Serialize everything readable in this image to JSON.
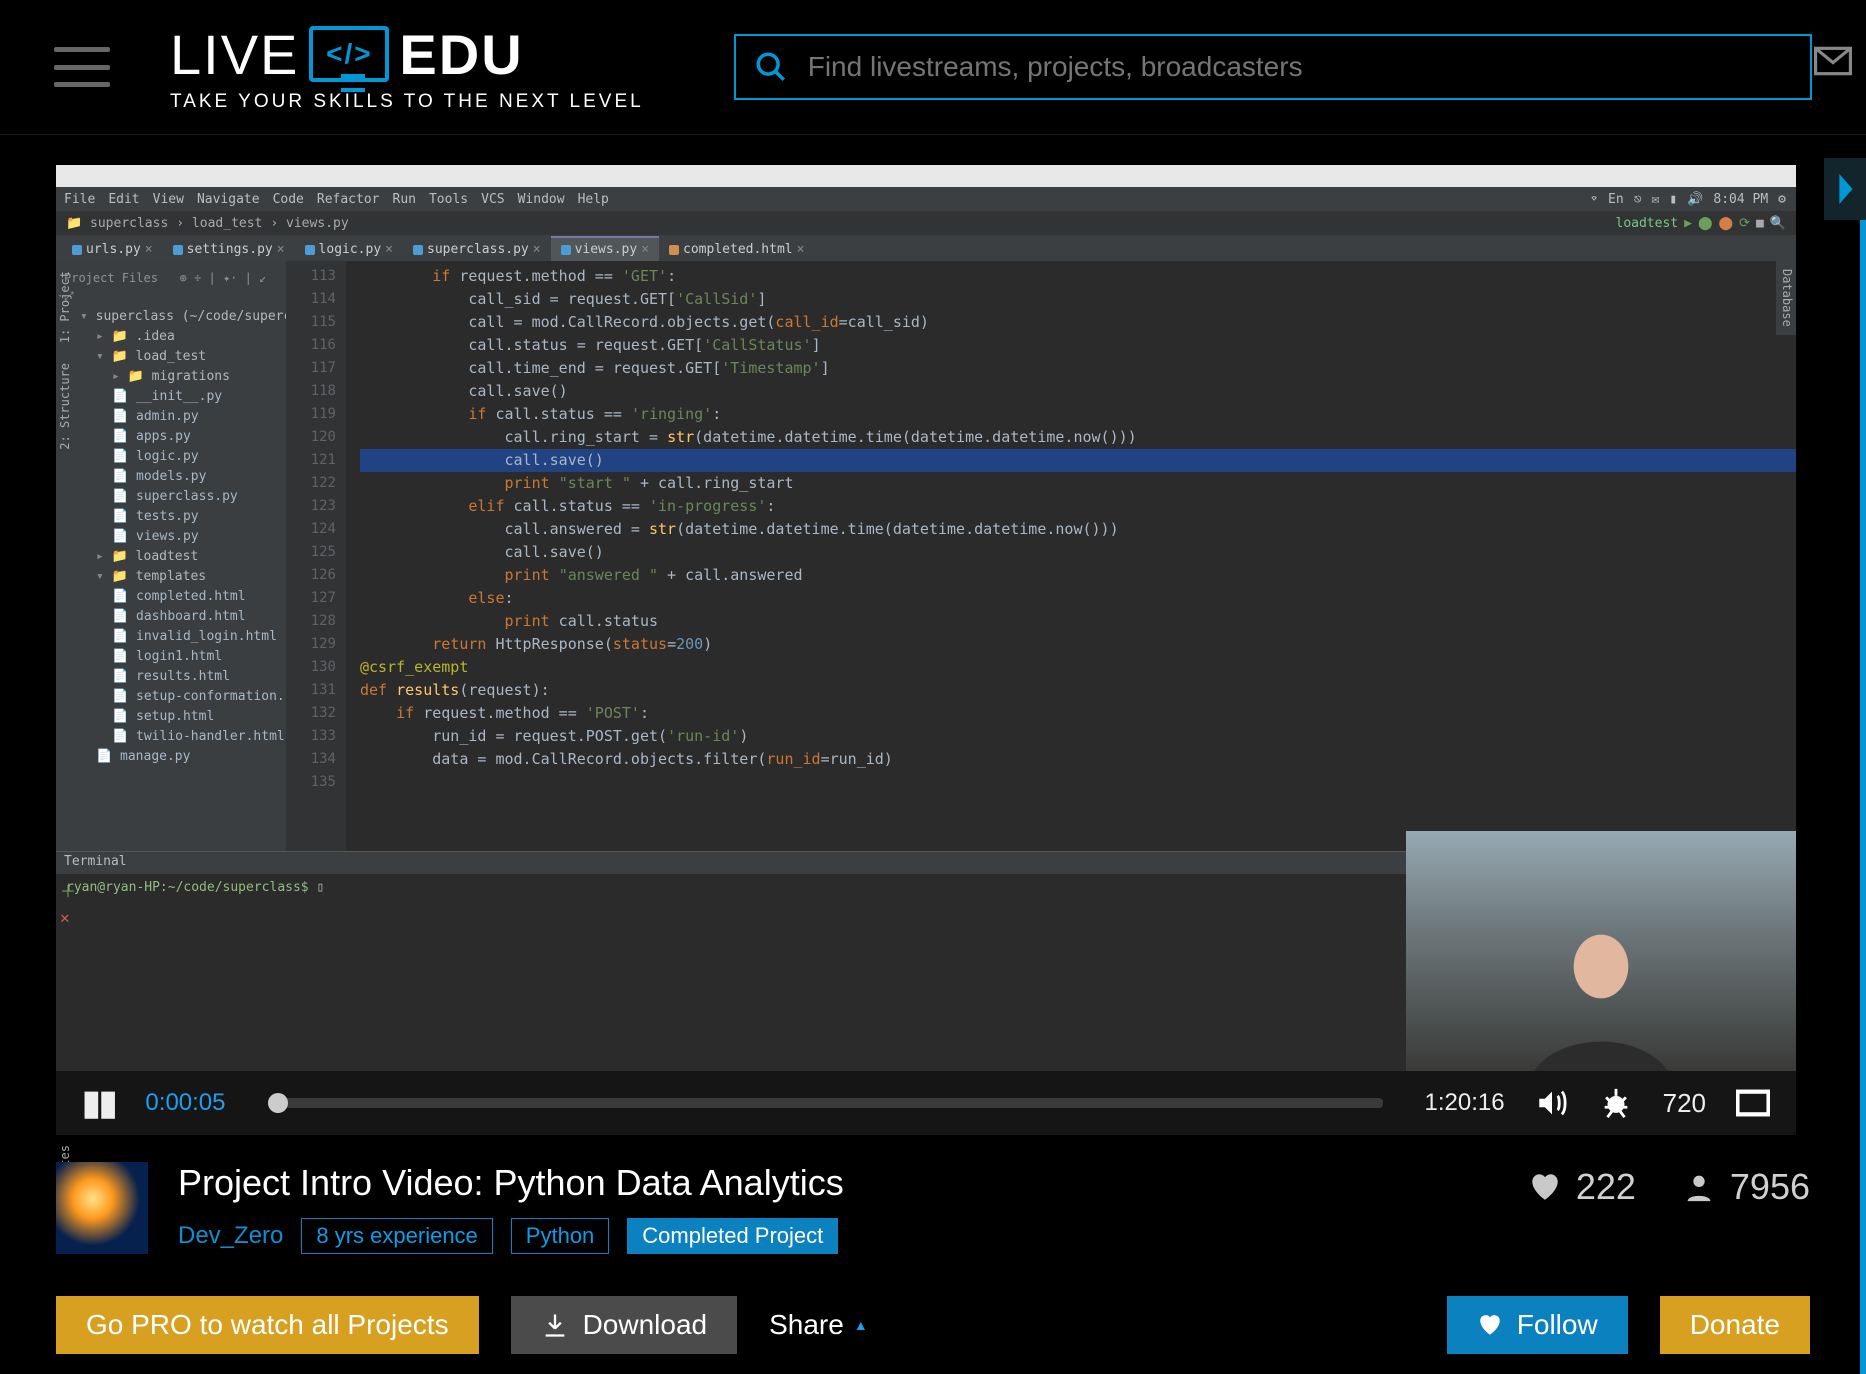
{
  "header": {
    "logo_a": "LIVE",
    "logo_code": "</>",
    "logo_b": "EDU",
    "tagline": "TAKE YOUR SKILLS TO THE NEXT LEVEL",
    "search_placeholder": "Find livestreams, projects, broadcasters"
  },
  "player": {
    "current_time": "0:00:05",
    "duration": "1:20:16",
    "quality": "720"
  },
  "video_meta": {
    "title": "Project Intro Video: Python Data Analytics",
    "creator": "Dev_Zero",
    "tags": [
      "8 yrs experience",
      "Python"
    ],
    "status_tag": "Completed Project",
    "likes": "222",
    "views": "7956"
  },
  "actions": {
    "go_pro": "Go PRO to watch all Projects",
    "download": "Download",
    "share": "Share",
    "follow": "Follow",
    "donate": "Donate"
  },
  "ide": {
    "menubar": [
      "File",
      "Edit",
      "View",
      "Navigate",
      "Code",
      "Refactor",
      "Run",
      "Tools",
      "VCS",
      "Window",
      "Help"
    ],
    "clock": "8:04 PM",
    "breadcrumb": [
      "superclass",
      "load_test",
      "views.py"
    ],
    "run_config": "loadtest",
    "project_header": "Project Files",
    "root": "superclass (~/code/superclass)",
    "tree": [
      {
        "t": "dir",
        "d": 1,
        "n": ".idea"
      },
      {
        "t": "diro",
        "d": 1,
        "n": "load_test"
      },
      {
        "t": "dir",
        "d": 2,
        "n": "migrations"
      },
      {
        "t": "f",
        "d": 2,
        "n": "__init__.py"
      },
      {
        "t": "f",
        "d": 2,
        "n": "admin.py"
      },
      {
        "t": "f",
        "d": 2,
        "n": "apps.py"
      },
      {
        "t": "f",
        "d": 2,
        "n": "logic.py"
      },
      {
        "t": "f",
        "d": 2,
        "n": "models.py"
      },
      {
        "t": "f",
        "d": 2,
        "n": "superclass.py"
      },
      {
        "t": "f",
        "d": 2,
        "n": "tests.py"
      },
      {
        "t": "f",
        "d": 2,
        "n": "views.py",
        "sel": true
      },
      {
        "t": "dir",
        "d": 1,
        "n": "loadtest"
      },
      {
        "t": "diro",
        "d": 1,
        "n": "templates"
      },
      {
        "t": "f",
        "d": 2,
        "n": "completed.html"
      },
      {
        "t": "f",
        "d": 2,
        "n": "dashboard.html"
      },
      {
        "t": "f",
        "d": 2,
        "n": "invalid_login.html"
      },
      {
        "t": "f",
        "d": 2,
        "n": "login1.html"
      },
      {
        "t": "f",
        "d": 2,
        "n": "results.html"
      },
      {
        "t": "f",
        "d": 2,
        "n": "setup-conformation.html"
      },
      {
        "t": "f",
        "d": 2,
        "n": "setup.html"
      },
      {
        "t": "f",
        "d": 2,
        "n": "twilio-handler.html"
      },
      {
        "t": "f",
        "d": 1,
        "n": "manage.py"
      }
    ],
    "tabs": [
      {
        "n": "urls.py",
        "ic": "b"
      },
      {
        "n": "settings.py",
        "ic": "b"
      },
      {
        "n": "logic.py",
        "ic": "b"
      },
      {
        "n": "superclass.py",
        "ic": "b"
      },
      {
        "n": "views.py",
        "ic": "b",
        "active": true
      },
      {
        "n": "completed.html",
        "ic": "o"
      }
    ],
    "left_tools": [
      "1: Project",
      "2: Structure"
    ],
    "right_tool": "Database",
    "bottom_left_tool": "Favorites",
    "line_start": 113,
    "highlight_line": 121,
    "code": [
      {
        "i": 2,
        "seg": [
          [
            "k",
            "if"
          ],
          [
            "p",
            " request.method == "
          ],
          [
            "s",
            "'GET'"
          ],
          [
            "p",
            ":"
          ]
        ]
      },
      {
        "i": 3,
        "seg": [
          [
            "p",
            "call_sid = request.GET["
          ],
          [
            "s",
            "'CallSid'"
          ],
          [
            "p",
            "]"
          ]
        ]
      },
      {
        "i": 3,
        "seg": [
          [
            "p",
            "call = mod.CallRecord.objects.get("
          ],
          [
            "self",
            "call_id"
          ],
          [
            "p",
            "=call_sid)"
          ]
        ]
      },
      {
        "i": 3,
        "seg": [
          [
            "p",
            "call.status = request.GET["
          ],
          [
            "s",
            "'CallStatus'"
          ],
          [
            "p",
            "]"
          ]
        ]
      },
      {
        "i": 3,
        "seg": [
          [
            "p",
            "call.time_end = request.GET["
          ],
          [
            "s",
            "'Timestamp'"
          ],
          [
            "p",
            "]"
          ]
        ]
      },
      {
        "i": 3,
        "seg": [
          [
            "p",
            "call.save()"
          ]
        ]
      },
      {
        "i": 3,
        "seg": [
          [
            "k",
            "if"
          ],
          [
            "p",
            " call.status == "
          ],
          [
            "s",
            "'ringing'"
          ],
          [
            "p",
            ":"
          ]
        ]
      },
      {
        "i": 4,
        "seg": [
          [
            "p",
            "call.ring_start = "
          ],
          [
            "fn",
            "str"
          ],
          [
            "p",
            "(datetime.datetime.time(datetime.datetime.now()))"
          ]
        ]
      },
      {
        "i": 4,
        "seg": [
          [
            "p",
            "call.save()"
          ]
        ]
      },
      {
        "i": 4,
        "seg": [
          [
            "k",
            "print "
          ],
          [
            "s",
            "\"start \""
          ],
          [
            "p",
            " + call.ring_start"
          ]
        ]
      },
      {
        "i": 3,
        "seg": [
          [
            "k",
            "elif"
          ],
          [
            "p",
            " call.status == "
          ],
          [
            "s",
            "'in-progress'"
          ],
          [
            "p",
            ":"
          ]
        ]
      },
      {
        "i": 4,
        "seg": [
          [
            "p",
            "call.answered = "
          ],
          [
            "fn",
            "str"
          ],
          [
            "p",
            "(datetime.datetime.time(datetime.datetime.now()))"
          ]
        ]
      },
      {
        "i": 4,
        "seg": [
          [
            "p",
            "call.save()"
          ]
        ]
      },
      {
        "i": 4,
        "seg": [
          [
            "k",
            "print "
          ],
          [
            "s",
            "\"answered \""
          ],
          [
            "p",
            " + call.answered"
          ]
        ]
      },
      {
        "i": 3,
        "seg": [
          [
            "k",
            "else"
          ],
          [
            "p",
            ":"
          ]
        ]
      },
      {
        "i": 4,
        "seg": [
          [
            "k",
            "print"
          ],
          [
            "p",
            " call.status"
          ]
        ]
      },
      {
        "i": 2,
        "seg": [
          [
            "k",
            "return"
          ],
          [
            "p",
            " HttpResponse("
          ],
          [
            "self",
            "status"
          ],
          [
            "p",
            "="
          ],
          [
            "n",
            "200"
          ],
          [
            "p",
            ")"
          ]
        ]
      },
      {
        "i": 0,
        "seg": [
          [
            "p",
            ""
          ]
        ]
      },
      {
        "i": 0,
        "seg": [
          [
            "d",
            "@csrf_exempt"
          ]
        ]
      },
      {
        "i": 0,
        "seg": [
          [
            "k",
            "def "
          ],
          [
            "fn",
            "results"
          ],
          [
            "p",
            "(request):"
          ]
        ]
      },
      {
        "i": 1,
        "seg": [
          [
            "k",
            "if"
          ],
          [
            "p",
            " request.method == "
          ],
          [
            "s",
            "'POST'"
          ],
          [
            "p",
            ":"
          ]
        ]
      },
      {
        "i": 2,
        "seg": [
          [
            "p",
            "run_id = request.POST.get("
          ],
          [
            "s",
            "'run-id'"
          ],
          [
            "p",
            ")"
          ]
        ]
      },
      {
        "i": 2,
        "seg": [
          [
            "p",
            "data = mod.CallRecord.objects.filter("
          ],
          [
            "self",
            "run_id"
          ],
          [
            "p",
            "=run_id)"
          ]
        ]
      }
    ],
    "terminal_tab": "Terminal",
    "terminal_prompt": "ryan@ryan-HP:~/code/superclass$ "
  }
}
